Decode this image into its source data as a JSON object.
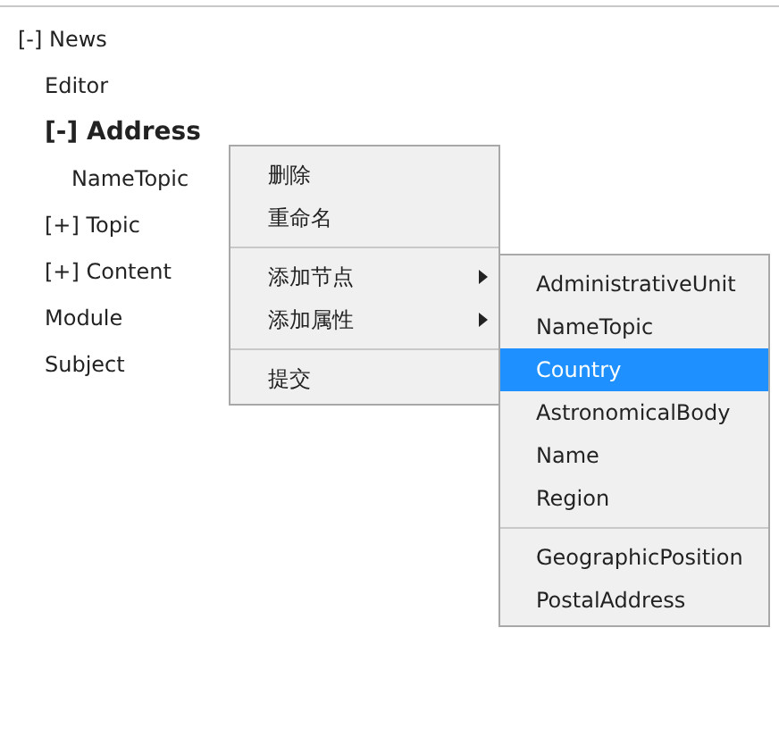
{
  "tree": [
    {
      "toggle": "[-]",
      "label": "News",
      "selected": false,
      "children": [
        {
          "label": "Editor",
          "selected": false
        },
        {
          "toggle": "[-]",
          "label": "Address",
          "selected": true,
          "children": [
            {
              "label": "NameTopic",
              "selected": false
            }
          ]
        },
        {
          "toggle": "[+]",
          "label": "Topic",
          "selected": false
        },
        {
          "toggle": "[+]",
          "label": "Content",
          "selected": false
        },
        {
          "label": "Module",
          "selected": false
        },
        {
          "label": "Subject",
          "selected": false
        }
      ]
    }
  ],
  "context_menu": {
    "groups": [
      [
        {
          "label": "删除",
          "submenu": false
        },
        {
          "label": "重命名",
          "submenu": false
        }
      ],
      [
        {
          "label": "添加节点",
          "submenu": true
        },
        {
          "label": "添加属性",
          "submenu": true
        }
      ],
      [
        {
          "label": "提交",
          "submenu": false
        }
      ]
    ]
  },
  "submenu": {
    "groups": [
      [
        {
          "label": "AdministrativeUnit",
          "selected": false
        },
        {
          "label": "NameTopic",
          "selected": false
        },
        {
          "label": "Country",
          "selected": true
        },
        {
          "label": "AstronomicalBody",
          "selected": false
        },
        {
          "label": "Name",
          "selected": false
        },
        {
          "label": "Region",
          "selected": false
        }
      ],
      [
        {
          "label": "GeographicPosition",
          "selected": false
        },
        {
          "label": "PostalAddress",
          "selected": false
        }
      ]
    ]
  }
}
